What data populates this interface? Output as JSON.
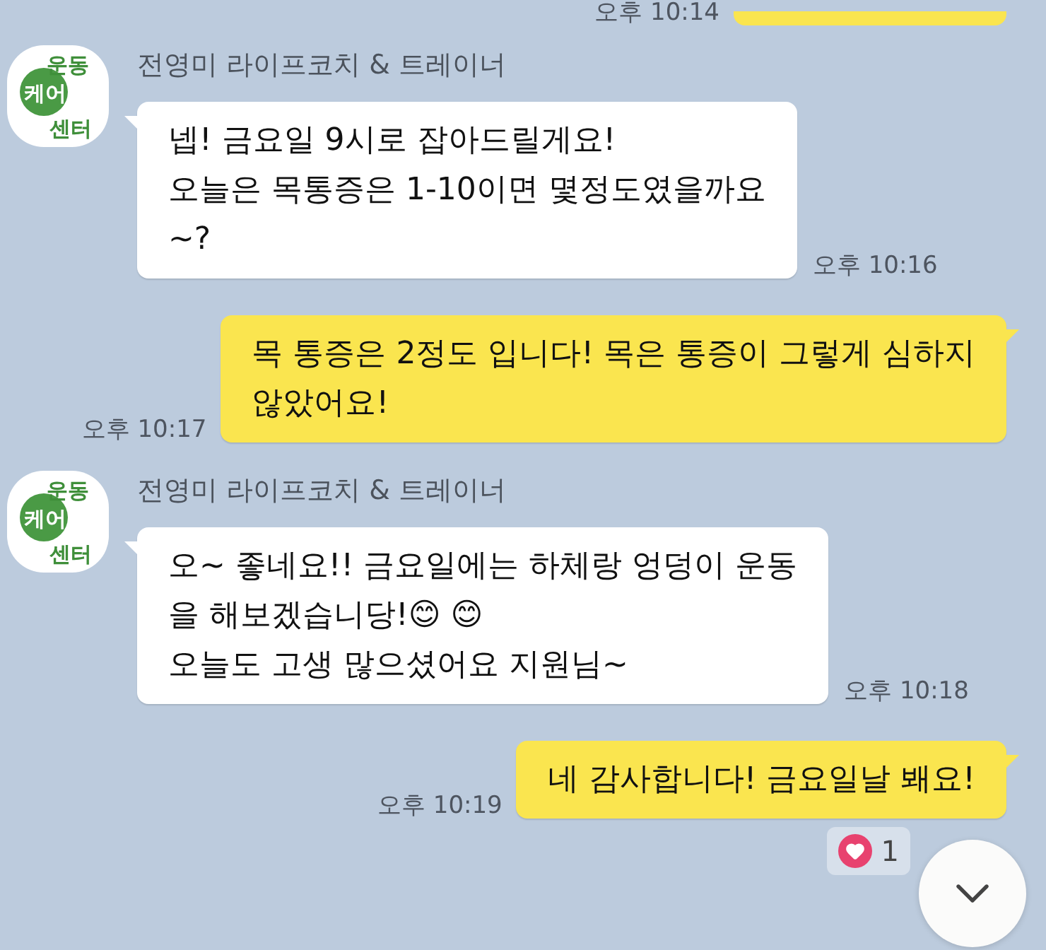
{
  "messages": [
    {
      "kind": "sent",
      "time": "오후 10:14"
    },
    {
      "kind": "received",
      "sender": "전영미 라이프코치 & 트레이너",
      "avatar_text": [
        "운동",
        "케어",
        "센터"
      ],
      "time": "오후 10:16",
      "lines": [
        "넵! 금요일 9시로 잡아드릴게요!",
        "오늘은 목통증은 1-10이면 몇정도였을까요",
        "~?"
      ]
    },
    {
      "kind": "sent",
      "time": "오후 10:17",
      "lines": [
        "목 통증은 2정도 입니다! 목은 통증이 그렇게 심하지",
        "않았어요!"
      ]
    },
    {
      "kind": "received",
      "sender": "전영미 라이프코치 & 트레이너",
      "avatar_text": [
        "운동",
        "케어",
        "센터"
      ],
      "time": "오후 10:18",
      "lines": [
        "오~ 좋네요!! 금요일에는 하체랑 엉덩이 운동",
        "을 해보겠습니당!😊 😊",
        "오늘도 고생 많으셨어요 지원님~"
      ]
    },
    {
      "kind": "sent",
      "time": "오후 10:19",
      "lines": [
        "네 감사합니다! 금요일날 봬요!"
      ],
      "reaction": {
        "count": "1"
      }
    }
  ]
}
